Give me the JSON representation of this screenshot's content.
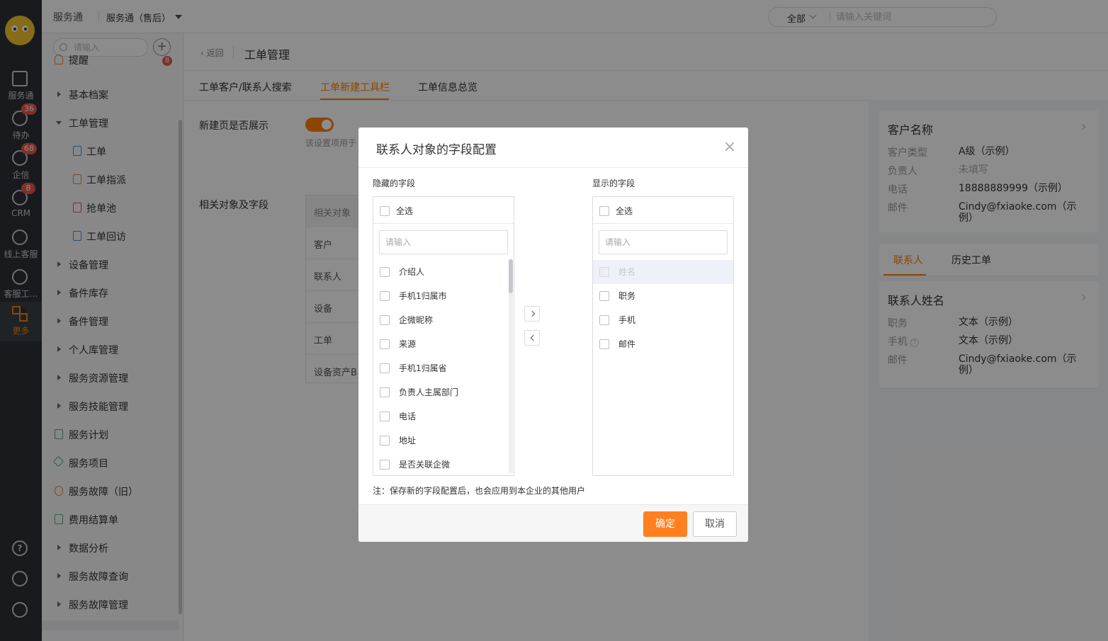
{
  "rail": {
    "items": [
      {
        "label": "服务通",
        "badge": ""
      },
      {
        "label": "待办",
        "badge": "36"
      },
      {
        "label": "企信",
        "badge": "68"
      },
      {
        "label": "CRM",
        "badge": "8"
      },
      {
        "label": "线上客服",
        "badge": ""
      },
      {
        "label": "客服工…",
        "badge": ""
      },
      {
        "label": "更多",
        "badge": ""
      }
    ],
    "help_glyph": "?"
  },
  "topbar": {
    "app_name": "服务通",
    "app_sub": "服务通（售后）",
    "search_scope": "全部",
    "search_placeholder": "请输入关键词"
  },
  "nav": {
    "search_placeholder": "请输入",
    "add_glyph": "+",
    "items": [
      {
        "label": "提醒",
        "badge": "8"
      },
      {
        "label": "基本档案"
      },
      {
        "label": "工单管理"
      },
      {
        "label": "工单"
      },
      {
        "label": "工单指派"
      },
      {
        "label": "抢单池"
      },
      {
        "label": "工单回访"
      },
      {
        "label": "设备管理"
      },
      {
        "label": "备件库存"
      },
      {
        "label": "备件管理"
      },
      {
        "label": "个人库管理"
      },
      {
        "label": "服务资源管理"
      },
      {
        "label": "服务技能管理"
      },
      {
        "label": "服务计划"
      },
      {
        "label": "服务项目"
      },
      {
        "label": "服务故障（旧）"
      },
      {
        "label": "费用结算单"
      },
      {
        "label": "数据分析"
      },
      {
        "label": "服务故障查询"
      },
      {
        "label": "服务故障管理"
      }
    ]
  },
  "main": {
    "back": "返回",
    "title": "工单管理",
    "tabs": [
      "工单客户/联系人搜索",
      "工单新建工具栏",
      "工单信息总览"
    ],
    "setting_show_label": "新建页是否展示",
    "setting_show_hint": "该设置项用于",
    "related_label": "相关对象及字段",
    "objects": [
      "相关对象",
      "客户",
      "联系人",
      "设备",
      "工单",
      "设备资产B"
    ]
  },
  "preview": {
    "customer_title": "客户名称",
    "customer_fields": [
      {
        "k": "客户类型",
        "v": "A级（示例）",
        "muted": false
      },
      {
        "k": "负责人",
        "v": "未填写",
        "muted": true
      },
      {
        "k": "电话",
        "v": "18888889999（示例）",
        "muted": false
      },
      {
        "k": "邮件",
        "v": "Cindy@fxiaoke.com（示例）",
        "muted": false
      }
    ],
    "tabs": [
      "联系人",
      "历史工单"
    ],
    "contact_title": "联系人姓名",
    "contact_fields": [
      {
        "k": "职务",
        "v": "文本（示例）"
      },
      {
        "k": "手机",
        "v": "文本（示例）"
      },
      {
        "k": "邮件",
        "v": "Cindy@fxiaoke.com（示例）"
      }
    ]
  },
  "modal": {
    "title": "联系人对象的字段配置",
    "close_glyph": "×",
    "hidden_label": "隐藏的字段",
    "shown_label": "显示的字段",
    "select_all": "全选",
    "filter_placeholder": "请输入",
    "hidden_fields": [
      "介绍人",
      "手机1归属市",
      "企微昵称",
      "来源",
      "手机1归属省",
      "负责人主属部门",
      "电话",
      "地址",
      "是否关联企微"
    ],
    "shown_fields": [
      {
        "label": "姓名",
        "disabled": true
      },
      {
        "label": "职务",
        "disabled": false
      },
      {
        "label": "手机",
        "disabled": false
      },
      {
        "label": "邮件",
        "disabled": false
      }
    ],
    "note": "注：保存新的字段配置后，也会应用到本企业的其他用户",
    "confirm": "确定",
    "cancel": "取消"
  },
  "colors": {
    "accent": "#ff8000",
    "rail_bg": "#2d3138",
    "badge": "#e8584c"
  }
}
